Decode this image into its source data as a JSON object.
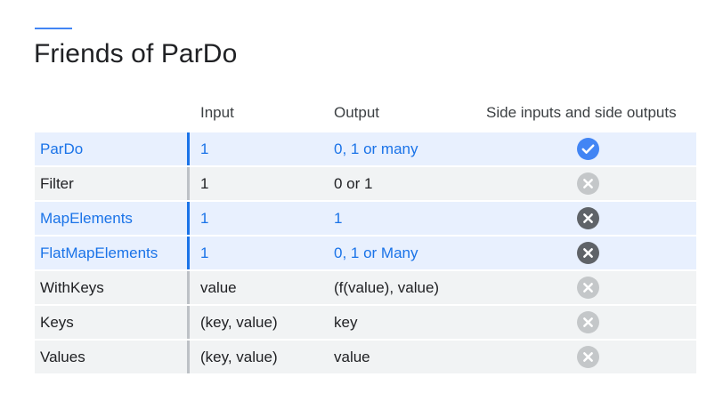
{
  "slide": {
    "title": "Friends of ParDo",
    "accent_color": "#4285f4"
  },
  "table": {
    "headers": {
      "input": "Input",
      "output": "Output",
      "side": "Side inputs and side outputs"
    },
    "rows": [
      {
        "name": "ParDo",
        "input": "1",
        "output": "0, 1 or many",
        "highlight": true,
        "side_support": "check-icon"
      },
      {
        "name": "Filter",
        "input": "1",
        "output": "0 or 1",
        "highlight": false,
        "side_support": "cross-light-icon"
      },
      {
        "name": "MapElements",
        "input": "1",
        "output": "1",
        "highlight": true,
        "side_support": "cross-dark-icon"
      },
      {
        "name": "FlatMapElements",
        "input": "1",
        "output": "0, 1 or Many",
        "highlight": true,
        "side_support": "cross-dark-icon"
      },
      {
        "name": "WithKeys",
        "input": "value",
        "output": "(f(value), value)",
        "highlight": false,
        "side_support": "cross-light-icon"
      },
      {
        "name": "Keys",
        "input": "(key, value)",
        "output": "key",
        "highlight": false,
        "side_support": "cross-light-icon"
      },
      {
        "name": "Values",
        "input": "(key, value)",
        "output": "value",
        "highlight": false,
        "side_support": "cross-light-icon"
      }
    ]
  },
  "colors": {
    "highlight_text": "#1a73e8",
    "highlight_row": "#e8f0fe",
    "normal_row": "#f1f3f4",
    "check": "#4285f4",
    "cross_light": "#c4c7c9",
    "cross_dark": "#5f6368"
  }
}
